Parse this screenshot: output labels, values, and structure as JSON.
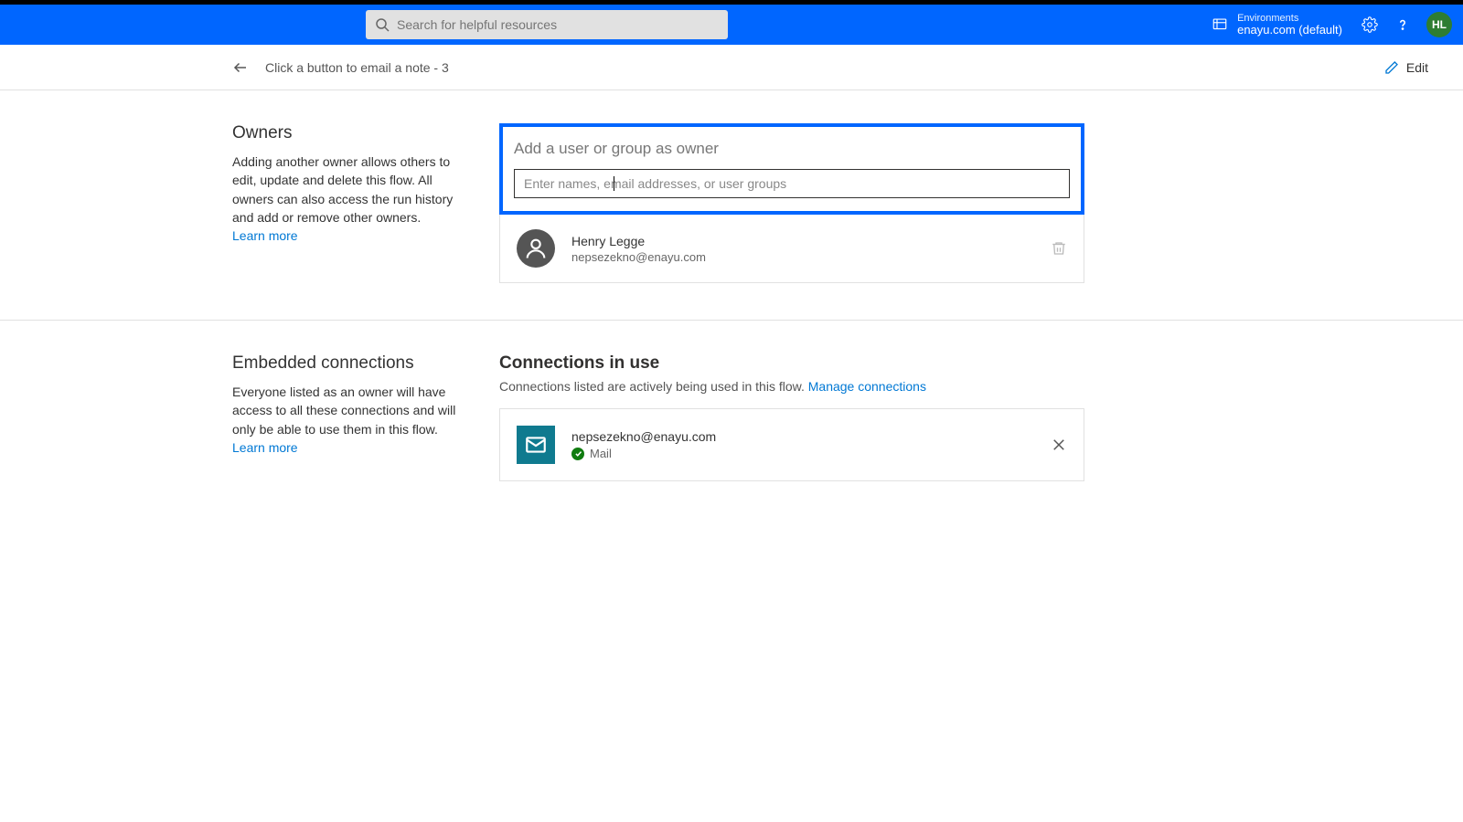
{
  "header": {
    "search_placeholder": "Search for helpful resources",
    "env_label": "Environments",
    "env_name": "enayu.com (default)",
    "avatar_initials": "HL"
  },
  "subheader": {
    "title": "Click a button to email a note - 3",
    "edit_label": "Edit"
  },
  "owners": {
    "heading": "Owners",
    "description": "Adding another owner allows others to edit, update and delete this flow. All owners can also access the run history and add or remove other owners.",
    "learn_more": "Learn more",
    "add_title": "Add a user or group as owner",
    "input_placeholder": "Enter names, email addresses, or user groups",
    "list": [
      {
        "name": "Henry Legge",
        "email": "nepsezekno@enayu.com"
      }
    ]
  },
  "connections": {
    "heading_left": "Embedded connections",
    "description": "Everyone listed as an owner will have access to all these connections and will only be able to use them in this flow.",
    "learn_more": "Learn more",
    "heading_right": "Connections in use",
    "subtext": "Connections listed are actively being used in this flow. ",
    "manage_link": "Manage connections",
    "items": [
      {
        "email": "nepsezekno@enayu.com",
        "service": "Mail"
      }
    ]
  }
}
